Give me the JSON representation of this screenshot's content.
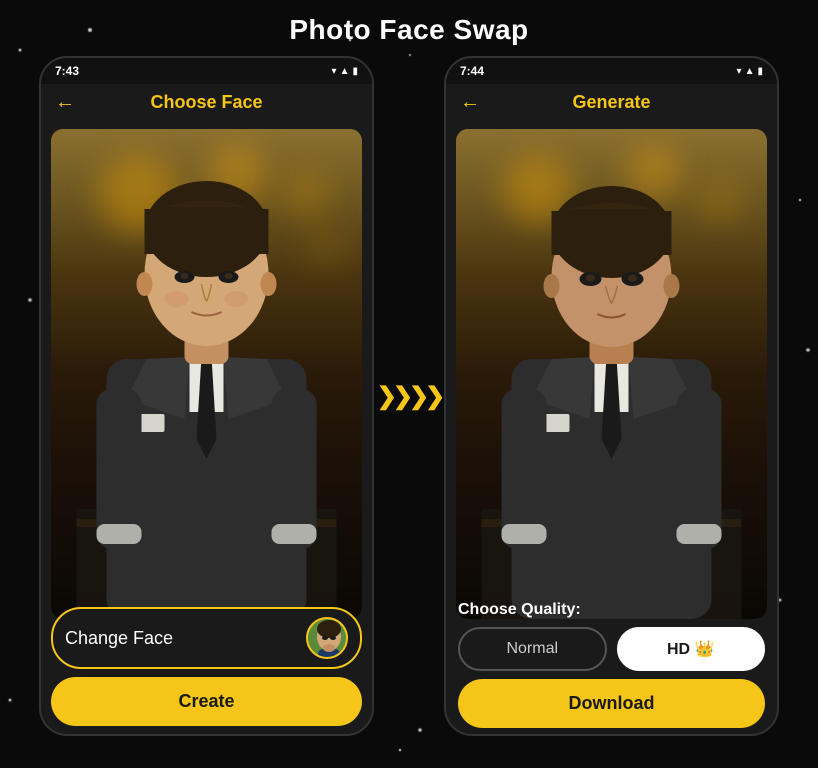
{
  "page": {
    "title": "Photo Face Swap",
    "background_color": "#0a0a0a"
  },
  "phone_left": {
    "status_time": "7:43",
    "header_title": "Choose Face",
    "header_color": "yellow",
    "change_face_label": "Change Face",
    "create_label": "Create"
  },
  "phone_right": {
    "status_time": "7:44",
    "header_title": "Generate",
    "header_color": "yellow",
    "quality_label": "Choose Quality:",
    "normal_label": "Normal",
    "hd_label": "HD 👑",
    "download_label": "Download"
  },
  "arrows": {
    "symbol": "❯❯❯❯"
  }
}
